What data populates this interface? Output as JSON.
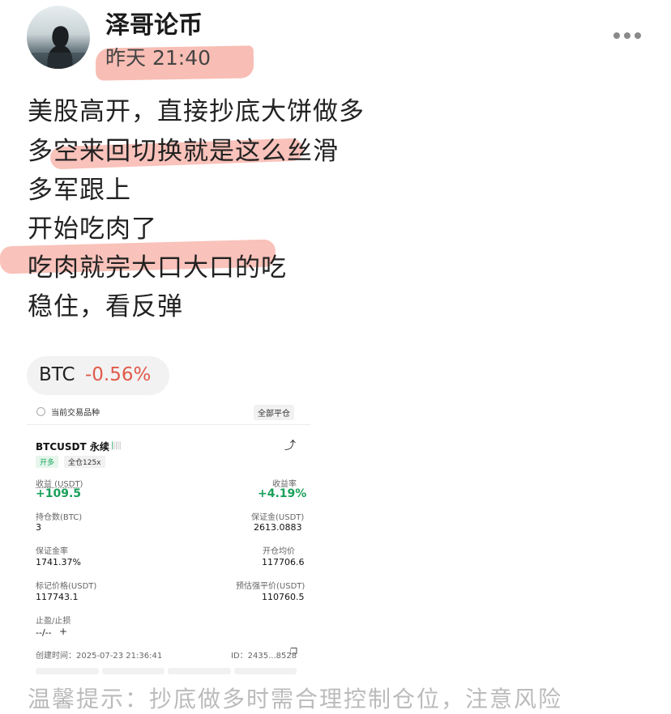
{
  "header": {
    "author": "泽哥论币",
    "time": "昨天 21:40",
    "more_icon": "more-dots-icon"
  },
  "post": {
    "lines": [
      "美股高开，直接抄底大饼做多",
      "多空来回切换就是这么丝滑",
      "多军跟上",
      "开始吃肉了",
      "吃肉就完大口大口的吃",
      "稳住，看反弹"
    ]
  },
  "ticker_tag": {
    "symbol": "BTC",
    "change": "-0.56%",
    "change_color": "#e05a4a"
  },
  "position_card": {
    "filter_label": "当前交易品种",
    "close_all_label": "全部平仓",
    "contract": "BTCUSDT 永续",
    "side_badge": "开多",
    "leverage_badge": "全仓125x",
    "pnl_label": "收益 (USDT)",
    "pnl_value": "+109.5",
    "roi_label": "收益率",
    "roi_value": "+4.19%",
    "size_label": "持仓数(BTC)",
    "size_value": "3",
    "margin_label": "保证金(USDT)",
    "margin_value": "2613.0883",
    "margin_ratio_label": "保证金率",
    "margin_ratio_value": "1741.37%",
    "entry_label": "开仓均价",
    "entry_value": "117706.6",
    "mark_label": "标记价格(USDT)",
    "mark_value": "117743.1",
    "liq_label": "预估强平价(USDT)",
    "liq_value": "110760.5",
    "tpsl_label": "止盈/止损",
    "tpsl_value": "--/--",
    "created_label": "创建时间：2025-07-23 21:36:41",
    "id_label": "ID：2435...8528",
    "positive_color": "#1aa05a"
  },
  "footer_text": "温馨提示：抄底做多时需合理控制仓位，注意风险"
}
